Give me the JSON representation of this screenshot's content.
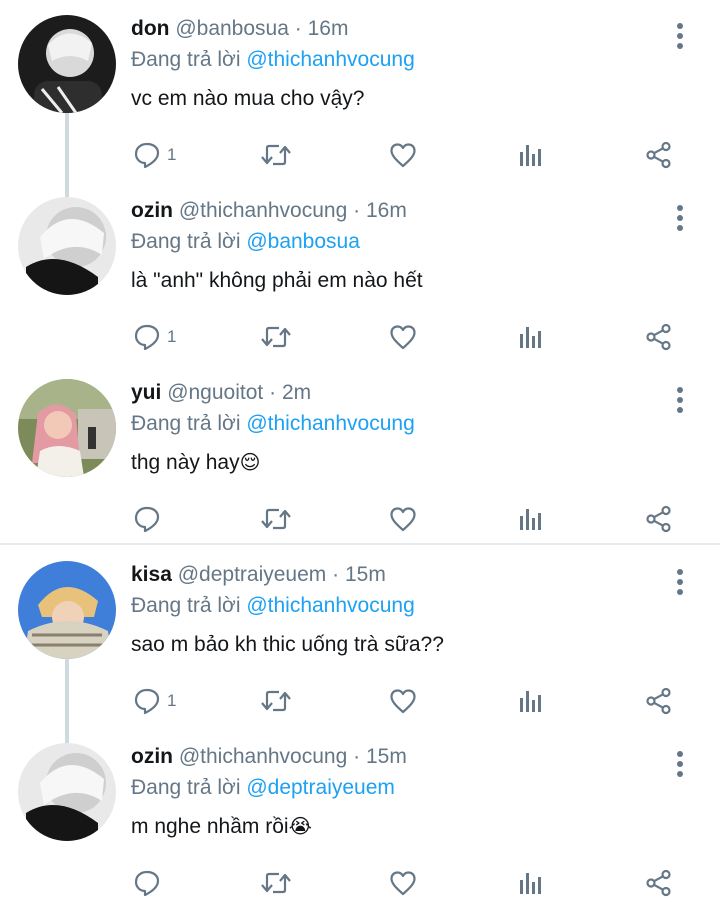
{
  "tweets": [
    {
      "name": "don",
      "handle": "@banbosua",
      "time": "16m",
      "replying_prefix": "Đang trả lời",
      "replying_to": "@thichanhvocung",
      "text": "vc em nào mua cho vậy?",
      "emoji": "",
      "reply_count": "1",
      "avatar": "avatar-don"
    },
    {
      "name": "ozin",
      "handle": "@thichanhvocung",
      "time": "16m",
      "replying_prefix": "Đang trả lời",
      "replying_to": "@banbosua",
      "text": "là \"anh\" không phải em nào hết",
      "emoji": "",
      "reply_count": "1",
      "avatar": "avatar-ozin"
    },
    {
      "name": "yui",
      "handle": "@nguoitot",
      "time": "2m",
      "replying_prefix": "Đang trả lời",
      "replying_to": "@thichanhvocung",
      "text": "thg này hay",
      "emoji": "😌",
      "reply_count": "",
      "avatar": "avatar-yui"
    },
    {
      "name": "kisa",
      "handle": "@deptraiyeuem",
      "time": "15m",
      "replying_prefix": "Đang trả lời",
      "replying_to": "@thichanhvocung",
      "text": "sao m bảo kh thic uống trà sữa??",
      "emoji": "",
      "reply_count": "1",
      "avatar": "avatar-kisa"
    },
    {
      "name": "ozin",
      "handle": "@thichanhvocung",
      "time": "15m",
      "replying_prefix": "Đang trả lời",
      "replying_to": "@deptraiyeuem",
      "text": "m nghe nhầm rồi",
      "emoji": "😭",
      "reply_count": "",
      "avatar": "avatar-ozin"
    }
  ],
  "separator": "·",
  "icons": [
    "reply-icon",
    "retweet-icon",
    "like-icon",
    "analytics-icon",
    "share-icon",
    "more-icon"
  ],
  "colors": {
    "accent": "#1da1f2",
    "muted": "#657786",
    "text": "#14171a",
    "thread_line": "#cfd9de"
  }
}
